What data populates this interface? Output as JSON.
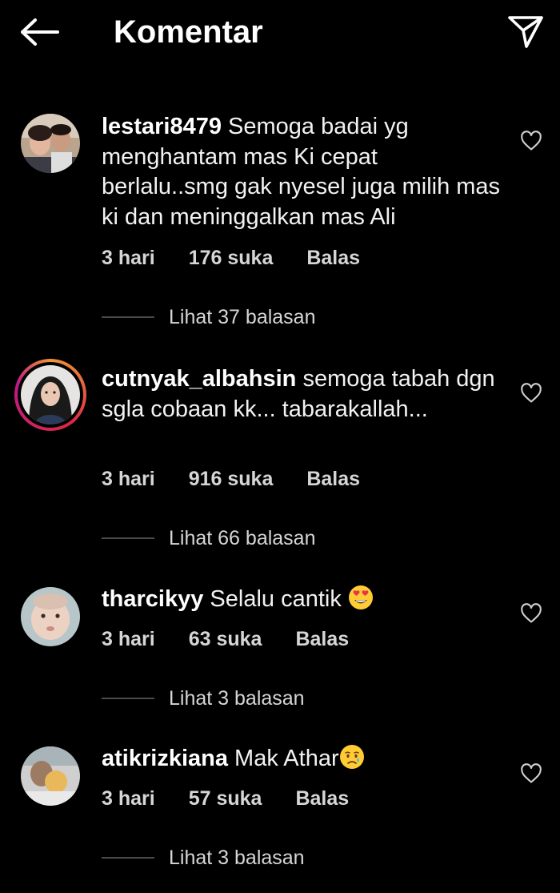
{
  "header": {
    "title": "Komentar",
    "back_icon": "arrow-left-icon",
    "send_icon": "send-icon"
  },
  "comments": [
    {
      "username": "lestari8479",
      "text": "Semoga badai yg menghantam mas Ki cepat berlalu..smg gak nyesel juga milih mas ki dan meninggalkan mas Ali",
      "time": "3 hari",
      "likes": "176 suka",
      "reply": "Balas",
      "view_replies": "Lihat 37 balasan",
      "has_story": false
    },
    {
      "username": "cutnyak_albahsin",
      "text": "semoga tabah dgn sgla cobaan kk... tabarakallah...",
      "time": "3 hari",
      "likes": "916 suka",
      "reply": "Balas",
      "view_replies": "Lihat 66 balasan",
      "has_story": true
    },
    {
      "username": "tharcikyy",
      "text": "Selalu cantik",
      "emoji": "heart-eyes-emoji",
      "time": "3 hari",
      "likes": "63 suka",
      "reply": "Balas",
      "view_replies": "Lihat 3 balasan",
      "has_story": false
    },
    {
      "username": "atikrizkiana",
      "text": "Mak Athar",
      "emoji": "crying-face-emoji",
      "time": "3 hari",
      "likes": "57 suka",
      "reply": "Balas",
      "view_replies": "Lihat 3 balasan",
      "has_story": false
    }
  ]
}
